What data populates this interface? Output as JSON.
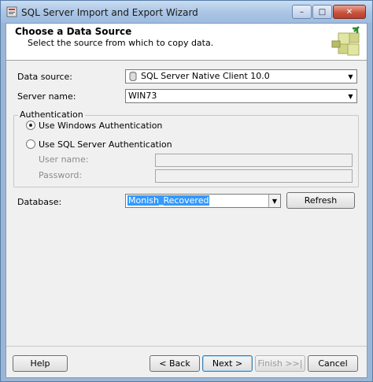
{
  "window": {
    "title": "SQL Server Import and Export Wizard",
    "controls": {
      "minimize": "–",
      "maximize": "□",
      "close": "✕"
    }
  },
  "header": {
    "title": "Choose a Data Source",
    "subtitle": "Select the source from which to copy data.",
    "graphic_icon": "wizard-puzzle-icon"
  },
  "form": {
    "data_source": {
      "label": "Data source:",
      "value": "SQL Server Native Client 10.0",
      "icon": "database-icon"
    },
    "server_name": {
      "label": "Server name:",
      "value": "WIN73"
    },
    "authentication": {
      "legend": "Authentication",
      "options": [
        {
          "label": "Use Windows Authentication",
          "checked": true
        },
        {
          "label": "Use SQL Server Authentication",
          "checked": false
        }
      ],
      "user_name_label": "User name:",
      "password_label": "Password:"
    },
    "database": {
      "label": "Database:",
      "value": "Monish_Recovered"
    },
    "refresh_label": "Refresh"
  },
  "footer": {
    "help": "Help",
    "back": "< Back",
    "next": "Next >",
    "finish": "Finish >>|",
    "cancel": "Cancel"
  }
}
